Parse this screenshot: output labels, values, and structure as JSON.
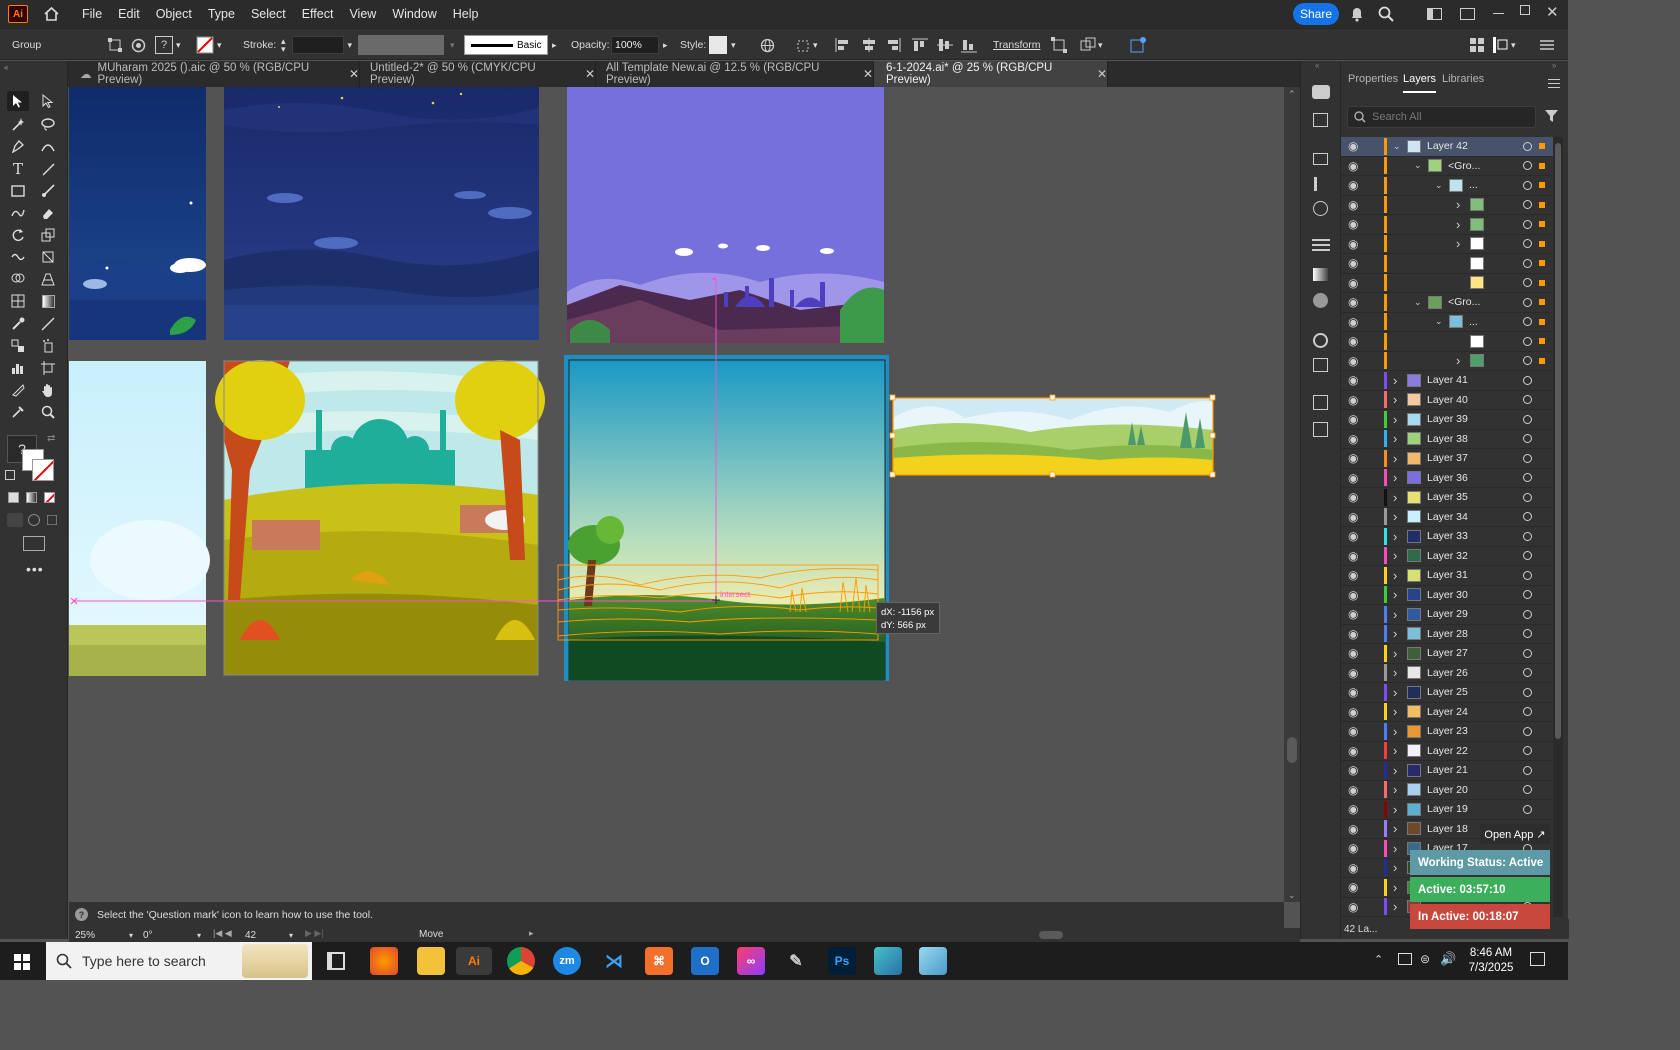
{
  "menubar": {
    "app_logo": "Ai",
    "items": [
      "File",
      "Edit",
      "Object",
      "Type",
      "Select",
      "Effect",
      "View",
      "Window",
      "Help"
    ],
    "share_label": "Share"
  },
  "controlbar": {
    "selection_label": "Group",
    "stroke_label": "Stroke:",
    "brush_label": "Basic",
    "opacity_label": "Opacity:",
    "opacity_value": "100%",
    "style_label": "Style:",
    "transform_label": "Transform"
  },
  "tabs": [
    {
      "label": "MUharam 2025 ().aic @ 50 % (RGB/CPU Preview)",
      "active": false
    },
    {
      "label": "Untitled-2* @ 50 % (CMYK/CPU Preview)",
      "active": false
    },
    {
      "label": "All Template New.ai @ 12.5 % (RGB/CPU Preview)",
      "active": false
    },
    {
      "label": "6-1-2024.ai* @ 25 % (RGB/CPU Preview)",
      "active": true
    }
  ],
  "canvas": {
    "smart_guide_label": "intersect",
    "tooltip_dx": "dX: -1156 px",
    "tooltip_dy": "dY: 566 px"
  },
  "panel": {
    "tabs": [
      "Properties",
      "Layers",
      "Libraries"
    ],
    "active_tab": "Layers",
    "search_placeholder": "Search All",
    "top_rows": [
      {
        "name": "Layer 42",
        "depth": 0,
        "chevron": "down",
        "color": "#ff9a00",
        "thumb": "#cfe6f2"
      },
      {
        "name": "<Gro...",
        "depth": 1,
        "chevron": "down",
        "color": "#ff9a00",
        "thumb": "#9fd37a"
      },
      {
        "name": "...",
        "depth": 2,
        "chevron": "down",
        "color": "#ff9a00",
        "thumb": "#bfe3f0"
      },
      {
        "name": "",
        "depth": 3,
        "chevron": "right",
        "color": "#ff9a00",
        "thumb": "#7fbf7a"
      },
      {
        "name": "",
        "depth": 3,
        "chevron": "right",
        "color": "#ff9a00",
        "thumb": "#7fbf7a"
      },
      {
        "name": "",
        "depth": 3,
        "chevron": "right",
        "color": "#ff9a00",
        "thumb": "#ffffff"
      },
      {
        "name": "",
        "depth": 3,
        "chevron": "",
        "color": "#ff9a00",
        "thumb": "#ffffff"
      },
      {
        "name": "",
        "depth": 3,
        "chevron": "",
        "color": "#ff9a00",
        "thumb": "#ffe680"
      },
      {
        "name": "<Gro...",
        "depth": 1,
        "chevron": "down",
        "color": "#ff9a00",
        "thumb": "#6aa05a"
      },
      {
        "name": "...",
        "depth": 2,
        "chevron": "down",
        "color": "#ff9a00",
        "thumb": "#79c0d8"
      },
      {
        "name": "",
        "depth": 3,
        "chevron": "",
        "color": "#ff9a00",
        "thumb": "#ffffff"
      },
      {
        "name": "",
        "depth": 3,
        "chevron": "right",
        "color": "#ff9a00",
        "thumb": "#4f9f6a"
      }
    ],
    "layers": [
      {
        "name": "Layer 41",
        "color": "#7d4cff",
        "thumb": "#8a7be0"
      },
      {
        "name": "Layer 40",
        "color": "#ff6a6a",
        "thumb": "#f2c9a0"
      },
      {
        "name": "Layer 39",
        "color": "#3bd13b",
        "thumb": "#a8d8f0"
      },
      {
        "name": "Layer 38",
        "color": "#2bb3ff",
        "thumb": "#9fd37a"
      },
      {
        "name": "Layer 37",
        "color": "#ff8c1a",
        "thumb": "#f4b86a"
      },
      {
        "name": "Layer 36",
        "color": "#ff4db8",
        "thumb": "#7b6ee0"
      },
      {
        "name": "Layer 35",
        "color": "#111111",
        "thumb": "#e8e070"
      },
      {
        "name": "Layer 34",
        "color": "#9a9a9a",
        "thumb": "#c9f0ff"
      },
      {
        "name": "Layer 33",
        "color": "#2ee6e6",
        "thumb": "#1f2e6a"
      },
      {
        "name": "Layer 32",
        "color": "#ff4db8",
        "thumb": "#2f6a4a"
      },
      {
        "name": "Layer 31",
        "color": "#ffd11a",
        "thumb": "#d8e070"
      },
      {
        "name": "Layer 30",
        "color": "#3bd13b",
        "thumb": "#27448a"
      },
      {
        "name": "Layer 29",
        "color": "#4d7dff",
        "thumb": "#2f5aa0"
      },
      {
        "name": "Layer 28",
        "color": "#4d7dff",
        "thumb": "#79c0d8"
      },
      {
        "name": "Layer 27",
        "color": "#ffd11a",
        "thumb": "#3f5f3a"
      },
      {
        "name": "Layer 26",
        "color": "#9a9a9a",
        "thumb": "#e8e8e8"
      },
      {
        "name": "Layer 25",
        "color": "#7d4cff",
        "thumb": "#1f2e5a"
      },
      {
        "name": "Layer 24",
        "color": "#ffd11a",
        "thumb": "#f0c060"
      },
      {
        "name": "Layer 23",
        "color": "#4d7dff",
        "thumb": "#e89a30"
      },
      {
        "name": "Layer 22",
        "color": "#ff3b3b",
        "thumb": "#f0f0ff"
      },
      {
        "name": "Layer 21",
        "color": "#1f2e9a",
        "thumb": "#2a2a6a"
      },
      {
        "name": "Layer 20",
        "color": "#ff6a6a",
        "thumb": "#a8d0f0"
      },
      {
        "name": "Layer 19",
        "color": "#8a0000",
        "thumb": "#5ab0d0"
      },
      {
        "name": "Layer 18",
        "color": "#9a7dff",
        "thumb": "#6a4a2a"
      },
      {
        "name": "Layer 17",
        "color": "#ff4db8",
        "thumb": "#3a6a8a"
      },
      {
        "name": "",
        "color": "#1f2e9a",
        "thumb": "#2a4a2a"
      },
      {
        "name": "",
        "color": "#ffd11a",
        "thumb": "#3a8a3a"
      },
      {
        "name": "",
        "color": "#7d4cff",
        "thumb": "#8a3a3a"
      }
    ],
    "layer_count_label": "42 La..."
  },
  "widget": {
    "open_app": "Open App ↗",
    "working_status": "Working Status: Active",
    "active_time": "Active: 03:57:10",
    "inactive_time": "In Active: 00:18:07"
  },
  "statusbar": {
    "help_text": "Select the 'Question mark' icon to learn how to use the tool.",
    "zoom": "25%",
    "rotation": "0°",
    "artboard": "42",
    "tool": "Move"
  },
  "taskbar": {
    "search_placeholder": "Type here to search",
    "time": "8:46 AM",
    "date": "7/3/2025"
  }
}
